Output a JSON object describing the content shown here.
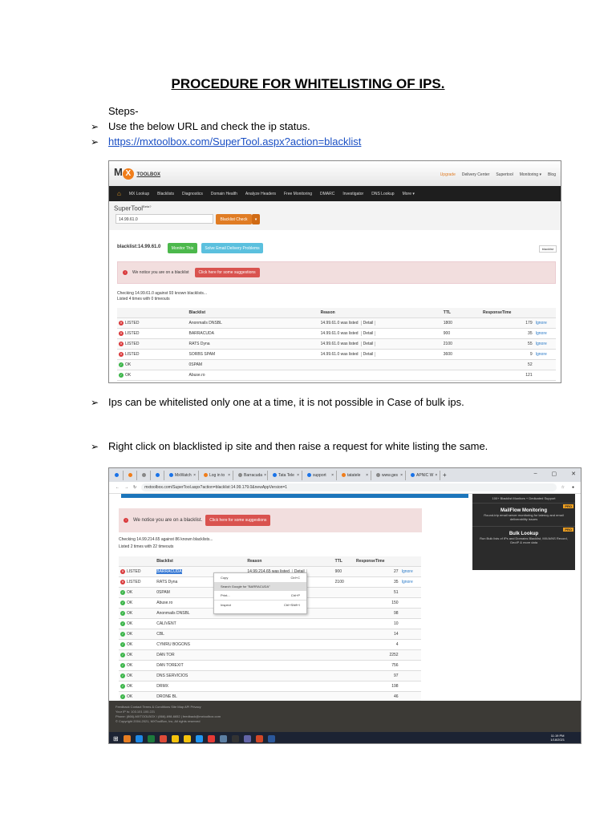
{
  "title": "PROCEDURE FOR WHITELISTING OF IPS.",
  "steps_label": "Steps-",
  "bullets": [
    "Use the below  URL and check the ip status.",
    "https://mxtoolbox.com/SuperTool.aspx?action=blacklist",
    "Ips can be whitelisted only one at a time, it is not possible in Case of bulk ips.",
    "Right click on blacklisted ip site and then raise a request for white listing the same."
  ],
  "shot1": {
    "logo_text": "TOOLBOX",
    "top_links": [
      "Upgrade",
      "Delivery Center",
      "Supertool",
      "Monitoring ▾",
      "Blog"
    ],
    "nav": [
      "MX Lookup",
      "Blacklists",
      "Diagnostics",
      "Domain Health",
      "Analyze Headers",
      "Free Monitoring",
      "DMARC",
      "Investigator",
      "DNS Lookup",
      "More ▾"
    ],
    "supertool": "SuperTool",
    "beta": "Beta?",
    "input_value": "14.99.61.0",
    "check_button": "Blacklist Check",
    "dropdown": "▾",
    "result_title": "blacklist:14.99.61.0",
    "monitor_button": "Monitor This",
    "solve_button": "Solve Email Delivery Problems",
    "blacklist_chip": "blacklist",
    "alert_text": "We notice you are on a blacklist",
    "alert_button": "Click here for some suggestions",
    "checking": "Checking 14.99.61.0 against 93 known blacklists...",
    "listed": "Listed 4 times with 0 timeouts",
    "headers": [
      "",
      "Blacklist",
      "Reason",
      "TTL",
      "ResponseTime",
      ""
    ],
    "rows": [
      {
        "status": "LISTED",
        "name": "Anonmails DNSBL",
        "reason": "14.99.61.0 was listed",
        "detail": "Detail",
        "ttl": "1800",
        "time": "179",
        "action": "Ignore"
      },
      {
        "status": "LISTED",
        "name": "BARRACUDA",
        "reason": "14.99.61.0 was listed",
        "detail": "Detail",
        "ttl": "900",
        "time": "35",
        "action": "Ignore"
      },
      {
        "status": "LISTED",
        "name": "RATS Dyna",
        "reason": "14.99.61.0 was listed",
        "detail": "Detail",
        "ttl": "2100",
        "time": "55",
        "action": "Ignore"
      },
      {
        "status": "LISTED",
        "name": "SORBS SPAM",
        "reason": "14.99.61.0 was listed",
        "detail": "Detail",
        "ttl": "3600",
        "time": "9",
        "action": "Ignore"
      },
      {
        "status": "OK",
        "name": "0SPAM",
        "reason": "",
        "detail": "",
        "ttl": "",
        "time": "52",
        "action": ""
      },
      {
        "status": "OK",
        "name": "Abuse.ro",
        "reason": "",
        "detail": "",
        "ttl": "",
        "time": "121",
        "action": ""
      }
    ]
  },
  "shot2": {
    "tabs": [
      "",
      "",
      "",
      "",
      "MxWatch",
      "Log in to",
      "Barracuda",
      "Tata Tele",
      "support",
      "tatatele",
      "www.ges",
      "APNIC W"
    ],
    "new_tab": "+",
    "window_controls": [
      "–",
      "▢",
      "✕"
    ],
    "url": "mxtoolbox.com/SuperTool.aspx?action=blacklist:14.99.179.0&newAppVersion=1",
    "alert_text": "We notice you are on a blacklist.",
    "alert_button": "Click here for some suggestions",
    "checking": "Checking 14.99.214.65 against 86 known blacklists...",
    "listed": "Listed 2 times with 22 timeouts",
    "side_top": "100+ Blacklist Monitors + Dedicated Support",
    "side_items": [
      {
        "title": "MailFlow Monitoring",
        "desc": "Round-trip email server monitoring for latency and email deliverability issues",
        "badge": "PRO"
      },
      {
        "title": "Bulk Lookup",
        "desc": "Run Bulk lists of IPs and Domains Blacklist, MX/A/NS Record, GeoIP & more data",
        "badge": "PRO"
      }
    ],
    "headers": [
      "",
      "Blacklist",
      "Reason",
      "TTL",
      "ResponseTime",
      ""
    ],
    "rows": [
      {
        "status": "LISTED",
        "name": "BARRACUDA",
        "reason": "14.99.214.65 was listed",
        "detail": "Detail",
        "ttl": "900",
        "time": "27",
        "action": "Ignore"
      },
      {
        "status": "LISTED",
        "name": "RATS Dyna",
        "reason": "14.99.214.65 was listed",
        "detail": "Detail",
        "ttl": "2100",
        "time": "35",
        "action": "Ignore"
      },
      {
        "status": "OK",
        "name": "0SPAM",
        "time": "51"
      },
      {
        "status": "OK",
        "name": "Abuse.ro",
        "time": "150"
      },
      {
        "status": "OK",
        "name": "Anonmails DNSBL",
        "time": "98"
      },
      {
        "status": "OK",
        "name": "CALIVENT",
        "time": "10"
      },
      {
        "status": "OK",
        "name": "CBL",
        "time": "14"
      },
      {
        "status": "OK",
        "name": "CYMRU BOGONS",
        "time": "4"
      },
      {
        "status": "OK",
        "name": "DAN TOR",
        "time": "2252"
      },
      {
        "status": "OK",
        "name": "DAN TOREXIT",
        "time": "756"
      },
      {
        "status": "OK",
        "name": "DNS SERVICIOS",
        "time": "97"
      },
      {
        "status": "OK",
        "name": "DRMX",
        "time": "198"
      },
      {
        "status": "OK",
        "name": "DRONE BL",
        "time": "46"
      }
    ],
    "context_menu": [
      {
        "label": "Copy",
        "shortcut": "Ctrl+C"
      },
      {
        "label": "Search Google for \"BARRACUDA\"",
        "shortcut": ""
      },
      {
        "label": "Print...",
        "shortcut": "Ctrl+P"
      },
      {
        "label": "Inspect",
        "shortcut": "Ctrl+Shift+I"
      }
    ],
    "footer_links": "Feedback  Contact  Terms & Conditions  Site Map  API  Privacy",
    "footer_ip": "Your IP is: 103.101.100.221",
    "footer_phone": "Phone: (866)-MXTOOLBOX / (866)-698-6652 | feedback@mxtoolbox.com",
    "footer_copy": "© Copyright 2004-2021, MXToolBox, Inc, All rights reserved",
    "clock_time": "11:19 PM",
    "clock_date": "1/18/2021"
  }
}
